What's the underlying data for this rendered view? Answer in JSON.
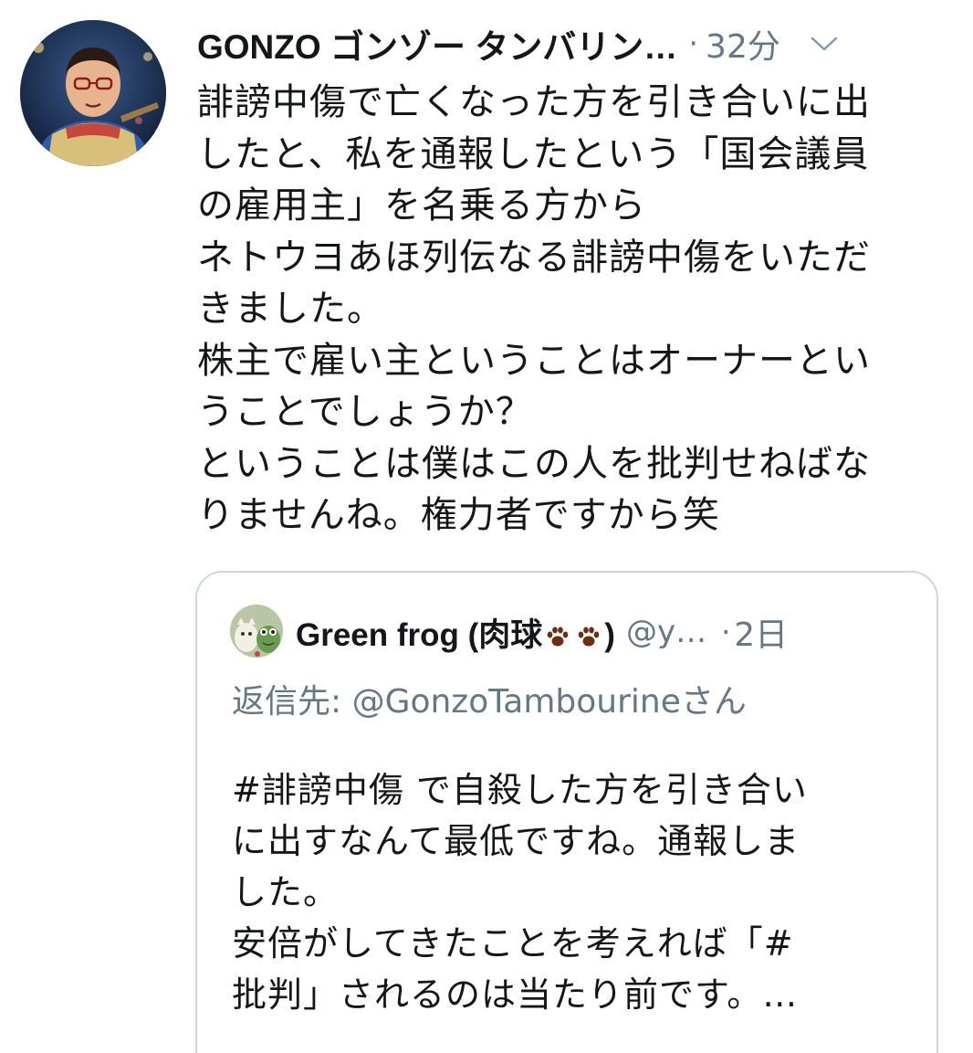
{
  "tweet": {
    "display_name": "GONZO ゴンゾー タンバリン…",
    "separator": "·",
    "timestamp": "32分",
    "text_lines": [
      "誹謗中傷で亡くなった方を引き合いに出",
      "したと、私を通報したという「国会議員",
      "の雇用主」を名乗る方から",
      "ネトウヨあほ列伝なる誹謗中傷をいただ",
      "きました。",
      "株主で雇い主ということはオーナーとい",
      "うことでしょうか？",
      "ということは僕はこの人を批判せねばな",
      "りませんね。権力者ですから笑"
    ]
  },
  "quoted_tweet": {
    "name_prefix": "Green frog (肉球",
    "name_suffix": ")",
    "handle": "@y…",
    "separator": "·",
    "timestamp": "2日",
    "reply_to": "返信先: @GonzoTambourineさん",
    "text_lines": [
      "#誹謗中傷 で自殺した方を引き合い",
      "に出すなんて最低ですね。通報しま",
      "した。",
      "安倍がしてきたことを考えれば「#",
      "批判」されるのは当たり前です。…"
    ]
  },
  "icons": {
    "caret": "chevron-down-icon",
    "paw": "paw-print-icon"
  },
  "colors": {
    "text_primary": "#14171a",
    "text_secondary": "#657786",
    "card_border": "#ccd6dd",
    "paw": "#6b2e12"
  }
}
